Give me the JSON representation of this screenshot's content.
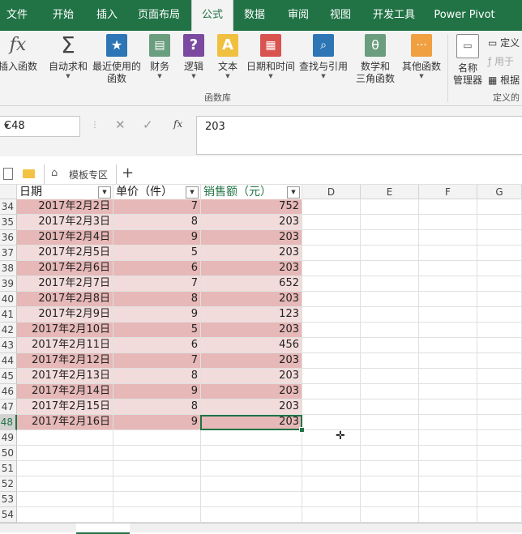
{
  "ribbon_tabs": [
    "文件",
    "开始",
    "插入",
    "页面布局",
    "公式",
    "数据",
    "审阅",
    "视图",
    "开发工具",
    "Power Pivot"
  ],
  "active_tab": "公式",
  "ribbon": {
    "insert_function": "插入函数",
    "autosum": "自动求和",
    "recent_1": "最近使用的",
    "recent_2": "函数",
    "financial": "财务",
    "logical": "逻辑",
    "text": "文本",
    "datetime": "日期和时间",
    "lookup": "查找与引用",
    "math_1": "数学和",
    "math_2": "三角函数",
    "more": "其他函数",
    "group_library": "函数库",
    "name_mgr_1": "名称",
    "name_mgr_2": "管理器",
    "define_name": "定义",
    "use_in_formula": "用于",
    "create_from": "根据",
    "group_defined": "定义的"
  },
  "formula_bar": {
    "name_box": "C48",
    "formula": "203",
    "fx": "fx"
  },
  "doc_tabs": {
    "template_area": "模板专区",
    "add": "+"
  },
  "columns": {
    "A": "日期",
    "B": "单价（件）",
    "C": "销售额（元）",
    "D": "D",
    "E": "E",
    "F": "F",
    "G": "G"
  },
  "rows": [
    {
      "n": "34",
      "date": "2017年2月2日",
      "price": "7",
      "sales": "752"
    },
    {
      "n": "35",
      "date": "2017年2月3日",
      "price": "8",
      "sales": "203"
    },
    {
      "n": "36",
      "date": "2017年2月4日",
      "price": "9",
      "sales": "203"
    },
    {
      "n": "37",
      "date": "2017年2月5日",
      "price": "5",
      "sales": "203"
    },
    {
      "n": "38",
      "date": "2017年2月6日",
      "price": "6",
      "sales": "203"
    },
    {
      "n": "39",
      "date": "2017年2月7日",
      "price": "7",
      "sales": "652"
    },
    {
      "n": "40",
      "date": "2017年2月8日",
      "price": "8",
      "sales": "203"
    },
    {
      "n": "41",
      "date": "2017年2月9日",
      "price": "9",
      "sales": "123"
    },
    {
      "n": "42",
      "date": "2017年2月10日",
      "price": "5",
      "sales": "203"
    },
    {
      "n": "43",
      "date": "2017年2月11日",
      "price": "6",
      "sales": "456"
    },
    {
      "n": "44",
      "date": "2017年2月12日",
      "price": "7",
      "sales": "203"
    },
    {
      "n": "45",
      "date": "2017年2月13日",
      "price": "8",
      "sales": "203"
    },
    {
      "n": "46",
      "date": "2017年2月14日",
      "price": "9",
      "sales": "203"
    },
    {
      "n": "47",
      "date": "2017年2月15日",
      "price": "8",
      "sales": "203"
    },
    {
      "n": "48",
      "date": "2017年2月16日",
      "price": "9",
      "sales": "203"
    }
  ],
  "empty_rows": [
    "49",
    "50",
    "51",
    "52",
    "53",
    "54"
  ],
  "colors": {
    "brand": "#217346",
    "band_dark": "#e6b8b7",
    "band_light": "#f2dcdb"
  }
}
